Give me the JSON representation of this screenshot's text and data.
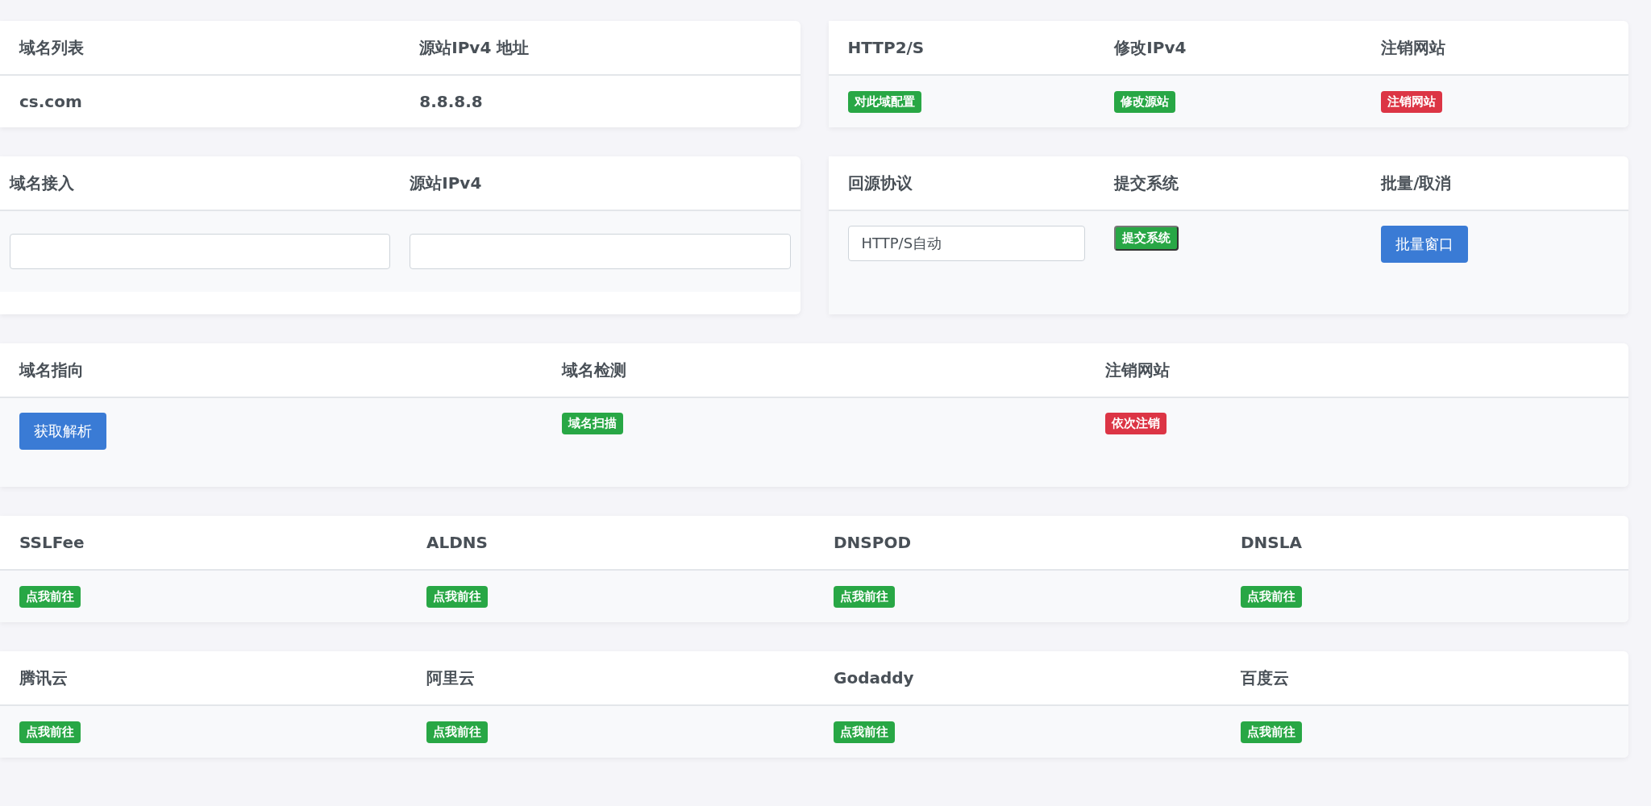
{
  "rows": [
    {
      "panels": [
        {
          "columns": [
            {
              "header": "域名列表",
              "cell": {
                "kind": "text",
                "text": "cs.com"
              }
            },
            {
              "header": "源站IPv4 地址",
              "cell": {
                "kind": "text",
                "text": "8.8.8.8"
              }
            }
          ]
        },
        {
          "columns": [
            {
              "header": "HTTP2/S",
              "cell": {
                "kind": "badge",
                "text": "对此域配置",
                "color": "#28a745"
              }
            },
            {
              "header": "修改IPv4",
              "cell": {
                "kind": "badge",
                "text": "修改源站",
                "color": "#28a745"
              }
            },
            {
              "header": "注销网站",
              "cell": {
                "kind": "badge",
                "text": "注销网站",
                "color": "#dc3545"
              }
            }
          ]
        }
      ]
    },
    {
      "panels": [
        {
          "columns": [
            {
              "header": "域名接入",
              "cell": {
                "kind": "field"
              }
            },
            {
              "header": "源站IPv4",
              "cell": {
                "kind": "field"
              }
            }
          ]
        },
        {
          "columns": [
            {
              "header": "回源协议",
              "cell": {
                "kind": "field",
                "value": "HTTP/S自动"
              }
            },
            {
              "header": "提交系统",
              "cell": {
                "kind": "raised-badge",
                "text": "提交系统",
                "color": "#28a745"
              }
            },
            {
              "header": "批量/取消",
              "cell": {
                "kind": "button",
                "text": "批量窗口"
              }
            }
          ]
        }
      ]
    },
    {
      "panels": [
        {
          "columns": [
            {
              "header": "域名指向",
              "cell": {
                "kind": "button",
                "text": "获取解析"
              }
            },
            {
              "header": "域名检测",
              "cell": {
                "kind": "badge",
                "text": "域名扫描",
                "color": "#28a745"
              }
            },
            {
              "header": "注销网站",
              "cell": {
                "kind": "badge",
                "text": "依次注销",
                "color": "#dc3545"
              }
            }
          ]
        }
      ]
    },
    {
      "panels": [
        {
          "columns": [
            {
              "header": "SSLFee",
              "cell": {
                "kind": "badge",
                "text": "点我前往",
                "color": "#28a745"
              }
            },
            {
              "header": "ALDNS",
              "cell": {
                "kind": "badge",
                "text": "点我前往",
                "color": "#28a745"
              }
            },
            {
              "header": "DNSPOD",
              "cell": {
                "kind": "badge",
                "text": "点我前往",
                "color": "#28a745"
              }
            },
            {
              "header": "DNSLA",
              "cell": {
                "kind": "badge",
                "text": "点我前往",
                "color": "#28a745"
              }
            }
          ]
        }
      ]
    },
    {
      "panels": [
        {
          "columns": [
            {
              "header": "腾讯云",
              "cell": {
                "kind": "badge",
                "text": "点我前往",
                "color": "#28a745"
              }
            },
            {
              "header": "阿里云",
              "cell": {
                "kind": "badge",
                "text": "点我前往",
                "color": "#28a745"
              }
            },
            {
              "header": "Godaddy",
              "cell": {
                "kind": "badge",
                "text": "点我前往",
                "color": "#28a745"
              }
            },
            {
              "header": "百度云",
              "cell": {
                "kind": "badge",
                "text": "点我前往",
                "color": "#28a745"
              }
            }
          ]
        }
      ]
    }
  ]
}
